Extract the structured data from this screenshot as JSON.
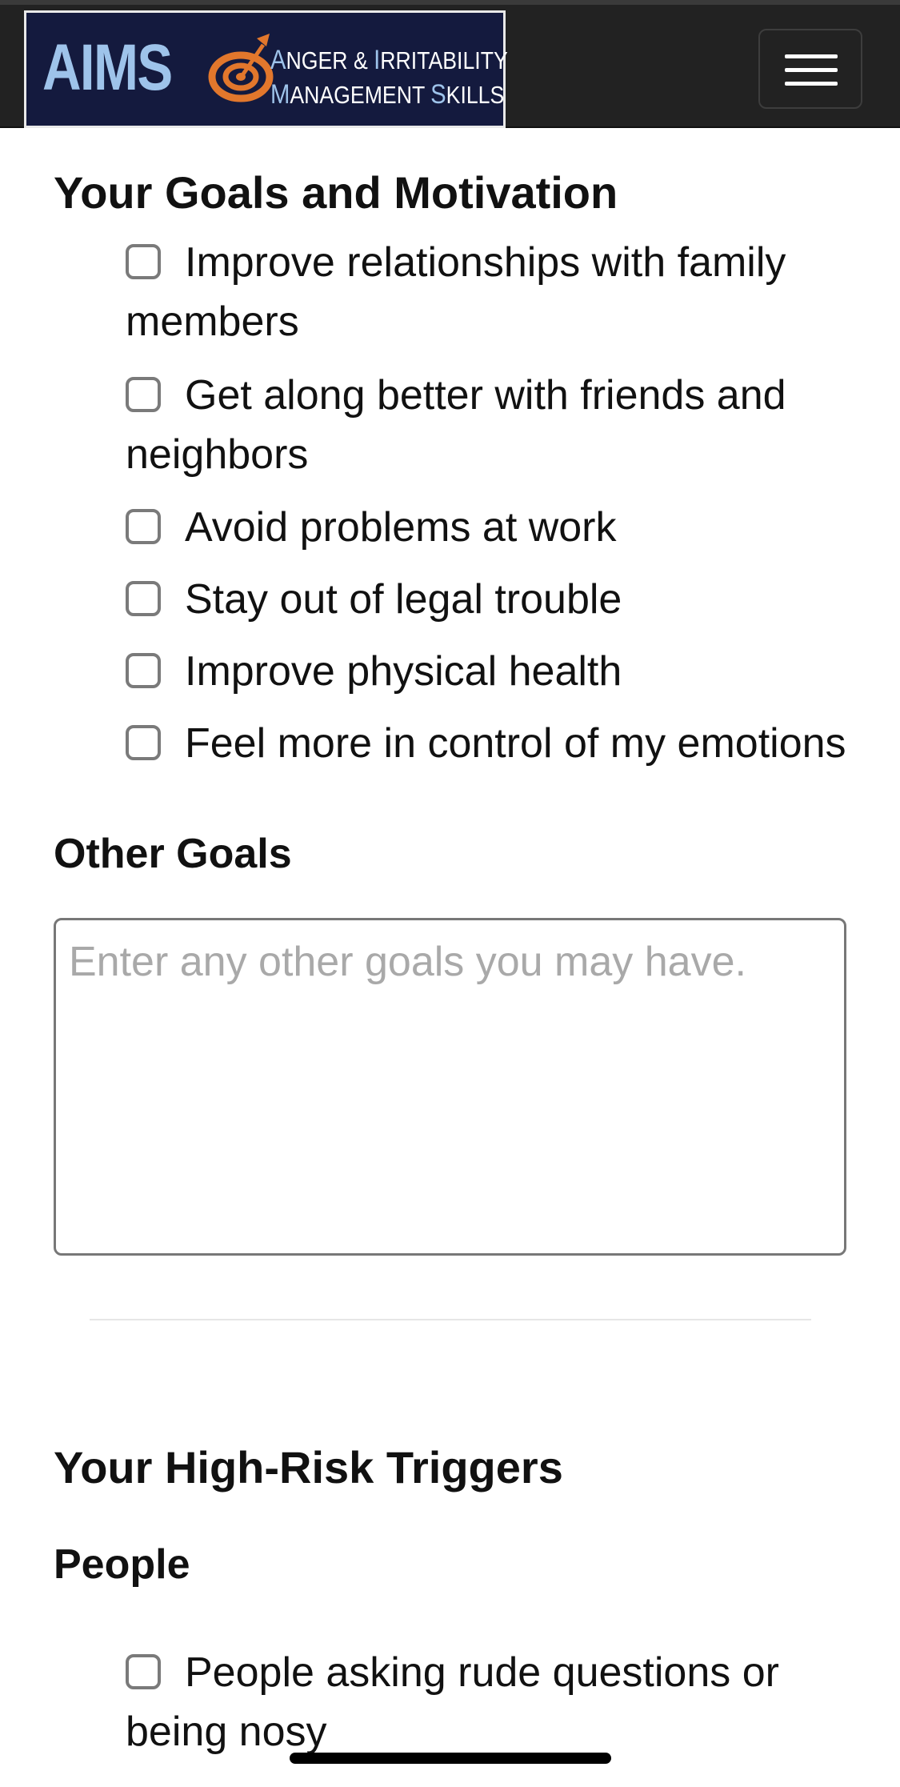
{
  "header": {
    "logo": {
      "short": "AIMS",
      "line1_cap1": "A",
      "line1_rest1": "NGER & ",
      "line1_cap2": "I",
      "line1_rest2": "RRITABILITY",
      "line2_cap1": "M",
      "line2_rest1": "ANAGEMENT ",
      "line2_cap2": "S",
      "line2_rest2": "KILLS"
    },
    "menu_icon": "hamburger-menu-icon"
  },
  "goals": {
    "title": "Your Goals and Motivation",
    "items": [
      {
        "label": "Improve relationships with family members",
        "checked": false
      },
      {
        "label": "Get along better with friends and neighbors",
        "checked": false
      },
      {
        "label": "Avoid problems at work",
        "checked": false
      },
      {
        "label": "Stay out of legal trouble",
        "checked": false
      },
      {
        "label": "Improve physical health",
        "checked": false
      },
      {
        "label": "Feel more in control of my emotions",
        "checked": false
      }
    ]
  },
  "other_goals": {
    "title": "Other Goals",
    "placeholder": "Enter any other goals you may have.",
    "value": ""
  },
  "triggers": {
    "title": "Your High-Risk Triggers",
    "people": {
      "title": "People",
      "items": [
        {
          "label": "People asking rude questions or being nosy",
          "checked": false
        }
      ]
    }
  },
  "colors": {
    "navbar": "#222222",
    "logo_bg": "#141a3e",
    "logo_accent": "#9ec3ea",
    "target_orange": "#e2772c"
  }
}
